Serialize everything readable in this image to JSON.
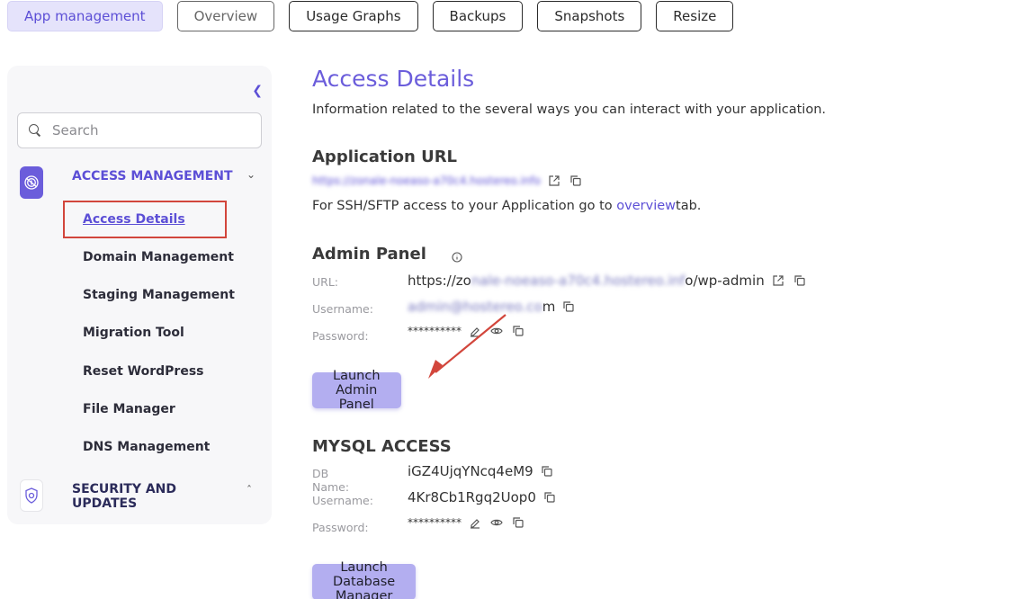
{
  "tabs": [
    "App management",
    "Overview",
    "Usage Graphs",
    "Backups",
    "Snapshots",
    "Resize"
  ],
  "sidebar": {
    "search_placeholder": "Search",
    "sections": [
      {
        "title": "ACCESS MANAGEMENT",
        "expanded": true
      },
      {
        "title": "SECURITY AND UPDATES",
        "expanded": false
      }
    ],
    "items": [
      "Access Details",
      "Domain Management",
      "Staging Management",
      "Migration Tool",
      "Reset WordPress",
      "File Manager",
      "DNS Management"
    ]
  },
  "main": {
    "title": "Access Details",
    "subtitle": "Information related to the several ways you can interact with your application.",
    "app_url": {
      "heading": "Application URL",
      "url": "https://zonale-noeaso-a70c4.hostereo.info",
      "ssh_pre": "For SSH/SFTP access to your Application go to ",
      "ssh_link": "overview",
      "ssh_post": " tab."
    },
    "admin": {
      "heading": "Admin Panel",
      "url_label": "URL:",
      "url_start": "https://zo",
      "url_blur": "nale-noeaso-a70c4.hostereo.inf",
      "url_end": "o/wp-admin",
      "user_label": "Username:",
      "user_blur": "admin@hostereo.co",
      "user_end": "m",
      "pass_label": "Password:",
      "pass_value": "**********",
      "button": "Launch Admin Panel"
    },
    "mysql": {
      "heading": "MYSQL ACCESS",
      "db_label": "DB Name:",
      "db_value": "iGZ4UjqYNcq4eM9",
      "user_label": "Username:",
      "user_value": "4Kr8Cb1Rgq2Uop0",
      "pass_label": "Password:",
      "pass_value": "**********",
      "button": "Launch Database Manager"
    }
  },
  "colors": {
    "accent": "#6b5ddb",
    "button": "#b3aef0",
    "highlight": "#d2463c"
  }
}
